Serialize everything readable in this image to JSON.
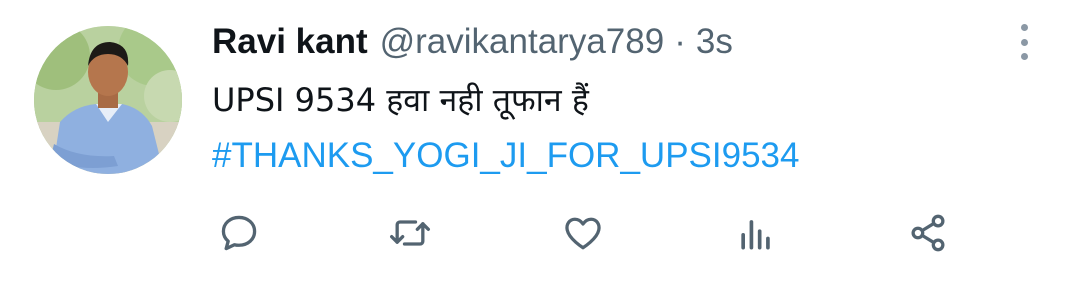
{
  "tweet": {
    "author_name": "Ravi kant",
    "handle": "@ravikantarya789",
    "separator": "·",
    "time": "3s",
    "text": "UPSI 9534 हवा नही तूफान हैं",
    "hashtag": "#THANKS_YOGI_JI_FOR_UPSI9534"
  },
  "icons": {
    "more": "more-vertical-icon",
    "reply": "reply-icon",
    "retweet": "retweet-icon",
    "like": "like-icon",
    "views": "analytics-icon",
    "share": "share-icon"
  },
  "colors": {
    "text": "#0f1419",
    "secondary": "#536471",
    "link": "#1d9bf0",
    "icon": "#536471"
  }
}
